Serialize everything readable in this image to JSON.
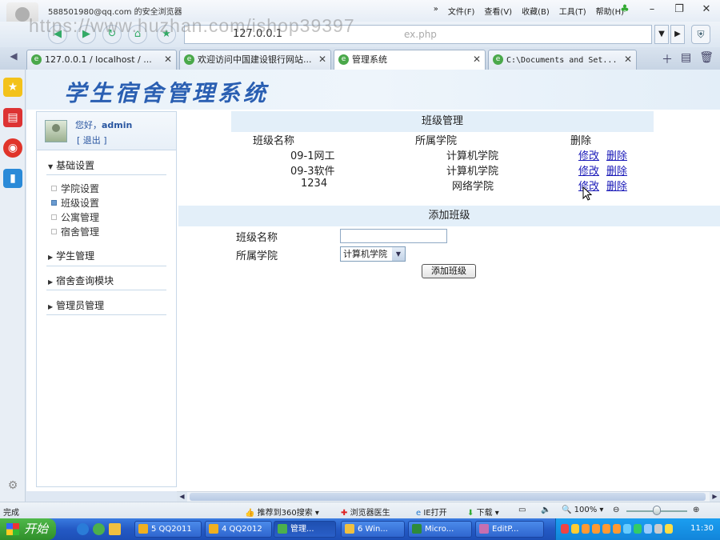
{
  "browser": {
    "title": "588501980@qq.com 的安全浏览器",
    "menu": [
      "»",
      "文件(F)",
      "查看(V)",
      "收藏(B)",
      "工具(T)",
      "帮助(H)"
    ],
    "url": "127.0.0.1",
    "url_tail": "ex.php",
    "watermark": "https://www.huzhan.com/ishop39397"
  },
  "tabs": [
    {
      "label": "127.0.0.1 / localhost / ...",
      "active": false
    },
    {
      "label": "欢迎访问中国建设银行网站...",
      "active": false
    },
    {
      "label": "管理系统",
      "active": true
    },
    {
      "label": "C:\\Documents and Set...",
      "active": false
    }
  ],
  "app": {
    "title": "学生宿舍管理系统",
    "user": {
      "greeting": "您好，",
      "name": "admin",
      "logout": "[ 退出 ]"
    },
    "nav": {
      "basic": "基础设置",
      "sub": [
        "学院设置",
        "班级设置",
        "公寓管理",
        "宿舍管理"
      ],
      "student": "学生管理",
      "query": "宿舍查询模块",
      "admin": "管理员管理"
    },
    "class_section": {
      "title": "班级管理",
      "headers": {
        "name": "班级名称",
        "college": "所属学院",
        "delete": "删除"
      },
      "rows": [
        {
          "name": "09-1网工",
          "college": "计算机学院",
          "edit": "修改",
          "delete": "删除"
        },
        {
          "name": "09-3软件",
          "college": "计算机学院",
          "edit": "修改",
          "delete": "删除"
        },
        {
          "name": "1234",
          "college": "网络学院",
          "edit": "修改",
          "delete": "删除"
        }
      ]
    },
    "add_section": {
      "title": "添加班级",
      "name_label": "班级名称",
      "name_value": "",
      "college_label": "所属学院",
      "college_selected": "计算机学院",
      "submit": "添加班级"
    }
  },
  "statusbar": {
    "status": "完成",
    "recommend": "推荐到360搜索",
    "doctor": "浏览器医生",
    "ie": "IE打开",
    "download": "下载",
    "zoom": "100%"
  },
  "taskbar": {
    "start": "开始",
    "tasks": [
      "5 QQ2011",
      "4 QQ2012",
      "管理...",
      "6 Win...",
      "Micro...",
      "EditP..."
    ],
    "clock": "11:30"
  }
}
